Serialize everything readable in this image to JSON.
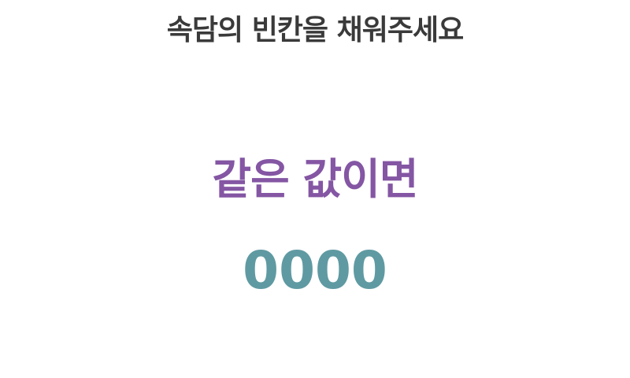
{
  "instruction": "속담의 빈칸을 채워주세요",
  "proverb": {
    "first_part": "같은 값이면",
    "blank": "0000"
  },
  "colors": {
    "instruction": "#3a3a3a",
    "first_part": "#8456a3",
    "blank": "#5f9aa2"
  }
}
